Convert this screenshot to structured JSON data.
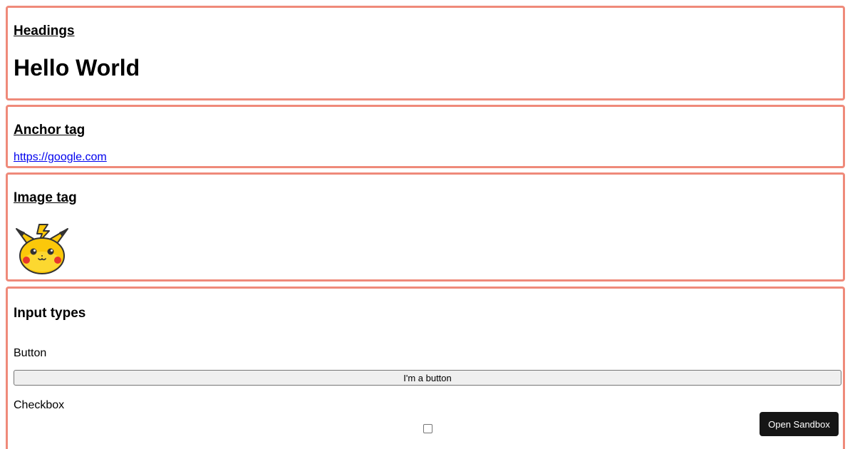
{
  "sections": {
    "headings": {
      "title": "Headings",
      "hello": "Hello World"
    },
    "anchor": {
      "title": "Anchor tag",
      "link_text": "https://google.com"
    },
    "image": {
      "title": "Image tag",
      "image_icon": "pikachu-icon"
    },
    "inputs": {
      "title": "Input types",
      "button_label": "Button",
      "button_text": "I'm a button",
      "checkbox_label": "Checkbox"
    }
  },
  "sandbox_button": "Open Sandbox",
  "colors": {
    "card_border": "#ef8a7a",
    "link": "#0000ee",
    "sandbox_bg": "#151515"
  }
}
